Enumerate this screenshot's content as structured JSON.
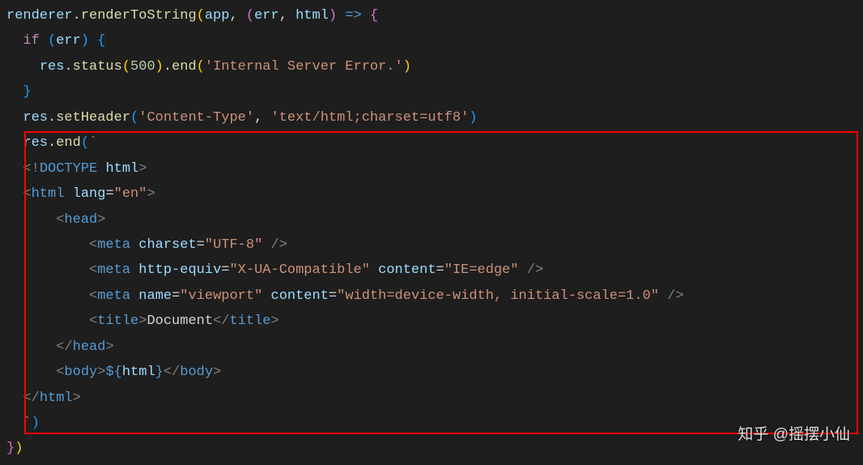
{
  "watermark": "知乎 @摇摆小仙",
  "code": {
    "line1": {
      "ident_renderer": "renderer",
      "dot1": ".",
      "method_renderToString": "renderToString",
      "open_paren": "(",
      "ident_app": "app",
      "comma": ", ",
      "arrow_open": "(",
      "ident_err": "err",
      "comma2": ", ",
      "ident_html": "html",
      "arrow_close": ")",
      "arrow": " => ",
      "brace_open": "{"
    },
    "line2": {
      "indent": "  ",
      "keyword_if": "if",
      "space": " ",
      "paren_open": "(",
      "ident_err": "err",
      "paren_close": ")",
      "space2": " ",
      "brace_open": "{"
    },
    "line3": {
      "indent": "    ",
      "ident_res": "res",
      "dot": ".",
      "method_status": "status",
      "paren_open": "(",
      "num_500": "500",
      "paren_close": ")",
      "dot2": ".",
      "method_end": "end",
      "paren_open2": "(",
      "string_error": "'Internal Server Error.'",
      "paren_close2": ")"
    },
    "line4": {
      "indent": "  ",
      "brace_close": "}"
    },
    "line5": {
      "indent": "  ",
      "ident_res": "res",
      "dot": ".",
      "method_setHeader": "setHeader",
      "paren_open": "(",
      "string_ct": "'Content-Type'",
      "comma": ", ",
      "string_val": "'text/html;charset=utf8'",
      "paren_close": ")"
    },
    "line6": {
      "indent": "  ",
      "ident_res": "res",
      "dot": ".",
      "method_end": "end",
      "paren_open": "(",
      "backtick": "`"
    },
    "line7": {
      "indent": "  ",
      "tag_open": "<!",
      "tagname": "DOCTYPE",
      "space": " ",
      "attr": "html",
      "tag_close": ">"
    },
    "line8": {
      "indent": "  ",
      "tag_open": "<",
      "tagname": "html",
      "space": " ",
      "attr_lang": "lang",
      "eq": "=",
      "attrval": "\"en\"",
      "tag_close": ">"
    },
    "line9": {
      "indent": "      ",
      "tag_open": "<",
      "tagname": "head",
      "tag_close": ">"
    },
    "line10": {
      "indent": "          ",
      "tag_open": "<",
      "tagname": "meta",
      "space": " ",
      "attr_charset": "charset",
      "eq": "=",
      "attrval": "\"UTF-8\"",
      "space2": " ",
      "tag_close": "/>"
    },
    "line11": {
      "indent": "          ",
      "tag_open": "<",
      "tagname": "meta",
      "space": " ",
      "attr_httpequiv": "http-equiv",
      "eq": "=",
      "attrval": "\"X-UA-Compatible\"",
      "space2": " ",
      "attr_content": "content",
      "eq2": "=",
      "attrval2": "\"IE=edge\"",
      "space3": " ",
      "tag_close": "/>"
    },
    "line12": {
      "indent": "          ",
      "tag_open": "<",
      "tagname": "meta",
      "space": " ",
      "attr_name": "name",
      "eq": "=",
      "attrval": "\"viewport\"",
      "space2": " ",
      "attr_content": "content",
      "eq2": "=",
      "attrval2": "\"width=device-width, initial-scale=1.0\"",
      "space3": " ",
      "tag_close": "/>"
    },
    "line13": {
      "indent": "          ",
      "tag_open": "<",
      "tagname_title": "title",
      "tag_close": ">",
      "text_document": "Document",
      "tag_open2": "</",
      "tagname_title2": "title",
      "tag_close2": ">"
    },
    "line14": {
      "indent": "      ",
      "tag_open": "</",
      "tagname": "head",
      "tag_close": ">"
    },
    "line15": {
      "indent": "      ",
      "tag_open": "<",
      "tagname": "body",
      "tag_close": ">",
      "tpl_open": "${",
      "tpl_var": "html",
      "tpl_close": "}",
      "tag_open2": "</",
      "tagname2": "body",
      "tag_close2": ">"
    },
    "line16": {
      "indent": "  ",
      "tag_open": "</",
      "tagname": "html",
      "tag_close": ">"
    },
    "line17": {
      "indent": "  ",
      "backtick": "`",
      "paren_close": ")"
    },
    "line18": {
      "brace_close": "}",
      "paren_close": ")"
    }
  }
}
